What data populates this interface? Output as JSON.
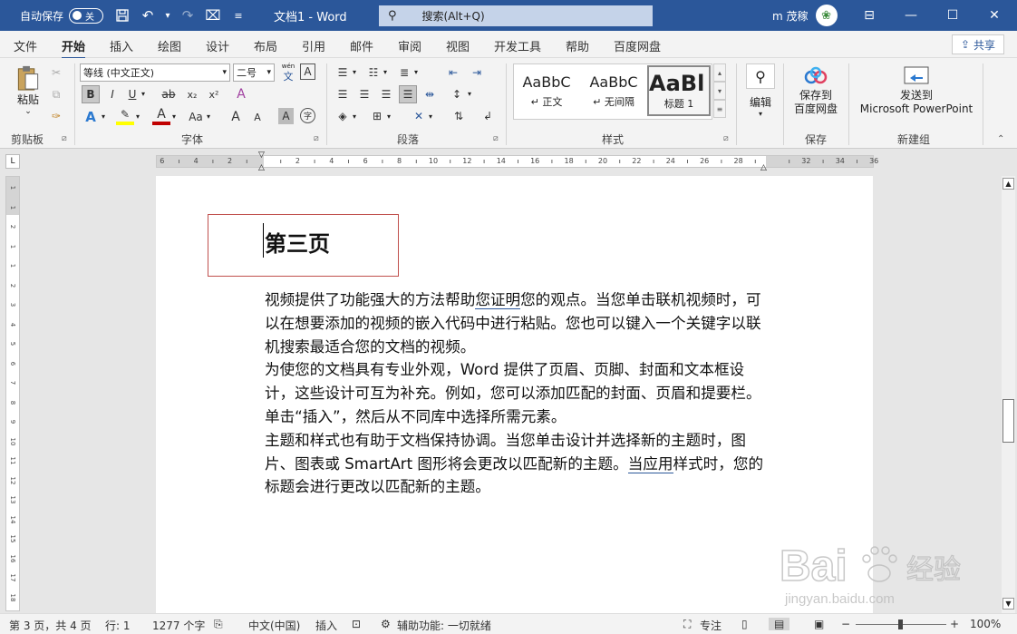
{
  "titlebar": {
    "autosave_label": "自动保存",
    "autosave_state": "关",
    "doc_title": "文档1  -  Word",
    "search_placeholder": "搜索(Alt+Q)",
    "user_name": "m 茂稼"
  },
  "menu": {
    "tabs": [
      "文件",
      "开始",
      "插入",
      "绘图",
      "设计",
      "布局",
      "引用",
      "邮件",
      "审阅",
      "视图",
      "开发工具",
      "帮助",
      "百度网盘"
    ],
    "active": "开始",
    "share_label": "共享"
  },
  "ribbon": {
    "clipboard": {
      "paste_label": "粘贴",
      "group_label": "剪贴板"
    },
    "font": {
      "font_name": "等线 (中文正文)",
      "font_size": "二号",
      "wen_label": "wén",
      "wen_char": "文",
      "a_char": "A",
      "group_label": "字体",
      "b": "B",
      "i": "I",
      "u": "U",
      "abc": "ab",
      "sub": "x₂",
      "sup": "x²",
      "clear": "A",
      "aa": "Aa",
      "grow": "A",
      "shrink": "A",
      "font_color": "A",
      "text_effect": "A",
      "highlight": "✎",
      "char_border": "A",
      "circle_char": "字"
    },
    "paragraph": {
      "group_label": "段落"
    },
    "styles": {
      "group_label": "样式",
      "cards": [
        {
          "preview": "AaBbC",
          "name": "↵ 正文"
        },
        {
          "preview": "AaBbC",
          "name": "↵ 无间隔"
        },
        {
          "preview": "AaBl",
          "name": "标题 1"
        }
      ]
    },
    "editing": {
      "label": "编辑"
    },
    "save": {
      "label1": "保存到",
      "label2": "百度网盘",
      "group_label": "保存"
    },
    "newgroup": {
      "label1": "发送到",
      "label2": "Microsoft PowerPoint",
      "group_label": "新建组"
    }
  },
  "ruler": {
    "labels": [
      "6",
      "4",
      "2",
      "2",
      "4",
      "6",
      "8",
      "10",
      "12",
      "14",
      "16",
      "18",
      "20",
      "22",
      "24",
      "26",
      "28",
      "32",
      "34",
      "36"
    ]
  },
  "document": {
    "heading": "第三页",
    "p1_a": "视频提供了功能强大的方法帮助",
    "p1_ul": "您证明",
    "p1_b": "您的观点。当您单击联机视频时，可以在想要添加的视频的嵌入代码中进行粘贴。您也可以键入一个关键字以联机搜索最适合您的文档的视频。",
    "p2": "为使您的文档具有专业外观，Word 提供了页眉、页脚、封面和文本框设计，这些设计可互为补充。例如，您可以添加匹配的封面、页眉和提要栏。单击“插入”，然后从不同库中选择所需元素。",
    "p3_a": "主题和样式也有助于文档保持协调。当您单击设计并选择新的主题时，图片、图表或 SmartArt 图形将会更改以匹配新的主题。",
    "p3_ul": "当应用",
    "p3_b": "样式时，您的标题会进行更改以匹配新的主题。"
  },
  "statusbar": {
    "page": "第 3 页，共 4 页",
    "line": "行: 1",
    "words": "1277 个字",
    "lang": "中文(中国)",
    "insert": "插入",
    "accessibility": "辅助功能: 一切就绪",
    "focus": "专注",
    "zoom": "100%"
  },
  "watermark": {
    "brand": "Bai",
    "brand2": "经验",
    "url": "jingyan.baidu.com"
  }
}
